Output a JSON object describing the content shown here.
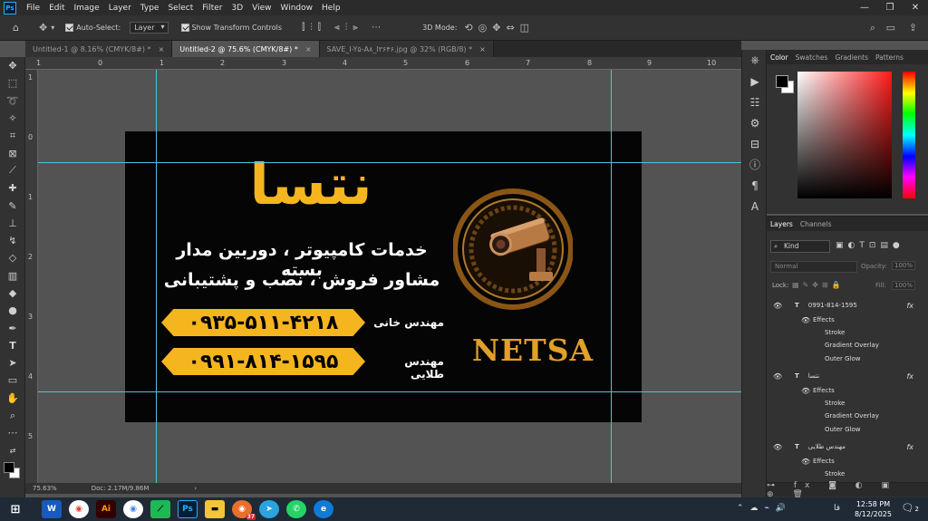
{
  "menubar": {
    "logo": "Ps",
    "items": [
      "File",
      "Edit",
      "Image",
      "Layer",
      "Type",
      "Select",
      "Filter",
      "3D",
      "View",
      "Window",
      "Help"
    ]
  },
  "options": {
    "auto_select_label": "Auto-Select:",
    "auto_select_target": "Layer",
    "show_transform_label": "Show Transform Controls",
    "mode_3d_label": "3D Mode:"
  },
  "tabs": [
    {
      "label": "Untitled-1 @ 8.16% (CMYK/8#) *"
    },
    {
      "label": "Untitled-2 @ 75.6% (CMYK/8#) *"
    },
    {
      "label": "SAVE_I-Y۵-A۸_I۳۶۴۶.jpg @ 32% (RGB/8) *"
    }
  ],
  "rulers": {
    "top": [
      "1",
      "0",
      "1",
      "2",
      "3",
      "4",
      "5",
      "6",
      "7",
      "8",
      "9",
      "10"
    ],
    "left": [
      "1",
      "0",
      "1",
      "2",
      "3",
      "4",
      "5"
    ]
  },
  "card": {
    "brand": "نتسا",
    "service_line_1": "خدمات کامپیوتر ، دوربین مدار بسته",
    "service_line_2": "مشاور فروش ، نصب و پشتیبانی",
    "phone_1": "۰۹۳۵-۵۱۱-۴۲۱۸",
    "engineer_1": "مهندس خانی",
    "phone_2": "۰۹۹۱-۸۱۴-۱۵۹۵",
    "engineer_2": "مهندس طلایی",
    "logo_text": "NETSA"
  },
  "status": {
    "zoom": "75.63%",
    "doc": "Doc: 2.17M/9.86M"
  },
  "color_panel": {
    "tabs": [
      "Color",
      "Swatches",
      "Gradients",
      "Patterns"
    ]
  },
  "layers_panel": {
    "tabs": [
      "Layers",
      "Channels"
    ],
    "filter_kind": "Kind",
    "blend_mode": "Normal",
    "opacity_label": "Opacity:",
    "opacity_value": "100%",
    "lock_label": "Lock:",
    "fill_label": "Fill:",
    "fill_value": "100%",
    "layers": [
      {
        "name": "0991-814-1595",
        "effects_label": "Effects",
        "effects": [
          "Stroke",
          "Gradient Overlay",
          "Outer Glow"
        ]
      },
      {
        "name": "نتسا",
        "effects_label": "Effects",
        "effects": [
          "Stroke",
          "Gradient Overlay",
          "Outer Glow"
        ]
      },
      {
        "name": "مهندس طلایی",
        "effects_label": "Effects",
        "effects": [
          "Stroke"
        ]
      }
    ]
  },
  "taskbar": {
    "time": "12:58 PM",
    "date": "8/12/2025",
    "lang": "فا",
    "notification_count": "2",
    "chrome_badge": "37"
  },
  "icons": [
    "ps-logo-icon",
    "home-icon",
    "move-icon",
    "search-icon",
    "workspace-icon",
    "share-icon"
  ],
  "colors": {
    "accent_yellow": "#f5b51f",
    "guide": "#4ec3d6",
    "card_bg": "#050505"
  }
}
